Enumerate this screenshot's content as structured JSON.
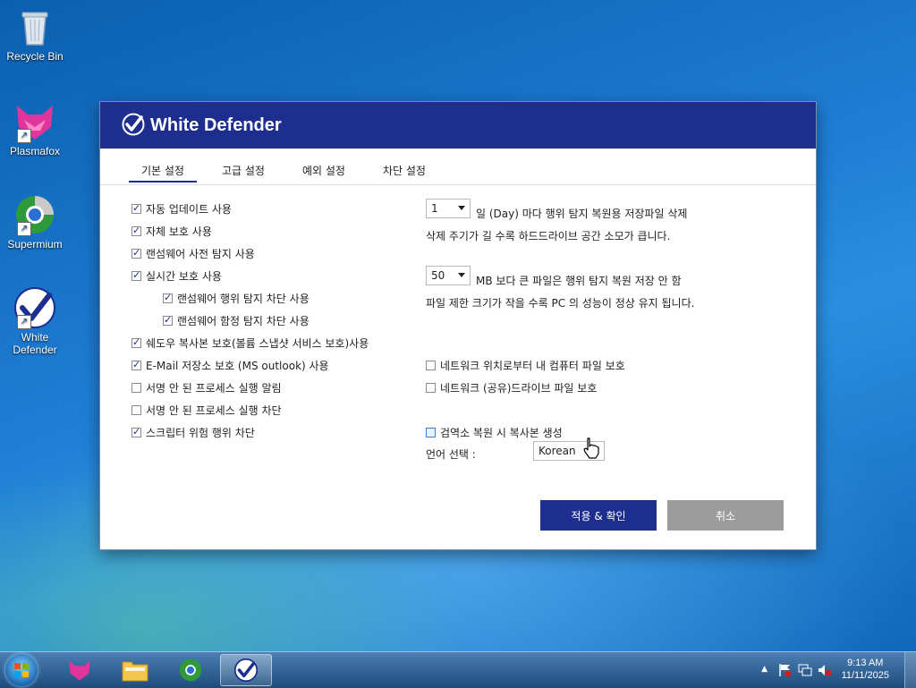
{
  "desktop": {
    "icons": [
      {
        "label": "Recycle Bin"
      },
      {
        "label": "Plasmafox"
      },
      {
        "label": "Supermium"
      },
      {
        "label_line1": "White",
        "label_line2": "Defender"
      }
    ]
  },
  "dialog": {
    "title": "White Defender",
    "tabs": [
      "기본 설정",
      "고급 설정",
      "예외 설정",
      "차단 설정"
    ],
    "active_tab": "기본 설정",
    "left_options": [
      {
        "label": "자동 업데이트 사용",
        "checked": true
      },
      {
        "label": "자체 보호 사용",
        "checked": true
      },
      {
        "label": "랜섬웨어 사전 탐지 사용",
        "checked": true
      },
      {
        "label": "실시간 보호 사용",
        "checked": true
      },
      {
        "label": "랜섬웨어 행위 탐지 차단 사용",
        "checked": true
      },
      {
        "label": "랜섬웨어 함정 탐지 차단 사용",
        "checked": true
      },
      {
        "label": "쉐도우 복사본 보호(볼륨 스냅샷 서비스 보호)사용",
        "checked": true
      },
      {
        "label": "E-Mail 저장소 보호 (MS outlook) 사용",
        "checked": true
      },
      {
        "label": "서명 안 된 프로세스 실행 알림",
        "checked": false
      },
      {
        "label": "서명 안 된 프로세스 실행 차단",
        "checked": false
      },
      {
        "label": "스크립터 위험 행위 차단",
        "checked": true
      }
    ],
    "backup_days": {
      "value": "1",
      "text": "일 (Day) 마다 행위 탐지 복원용 저장파일 삭제",
      "note": "삭제 주기가 길 수록 하드드라이브 공간 소모가 큽니다."
    },
    "file_limit": {
      "value": "50",
      "text": "MB 보다 큰 파일은 행위 탐지 복원 저장 안 함",
      "note": "파일 제한 크기가 작을 수록 PC 의 성능이 정상 유지 됩니다."
    },
    "right_options": [
      {
        "label": "네트워크 위치로부터 내 컴퓨터 파일 보호",
        "checked": false
      },
      {
        "label": "네트워크 (공유)드라이브 파일 보호",
        "checked": false
      },
      {
        "label": "검역소 복원 시 복사본 생성",
        "checked": false
      }
    ],
    "language": {
      "label": "언어 선택 :",
      "value": "Korean"
    },
    "buttons": {
      "apply": "적용 & 확인",
      "cancel": "취소"
    },
    "colors": {
      "header": "#1d2e8e",
      "apply": "#1d2e8e",
      "cancel": "#9c9c9c"
    }
  },
  "taskbar": {
    "time": "9:13 AM",
    "date": "11/11/2025"
  }
}
